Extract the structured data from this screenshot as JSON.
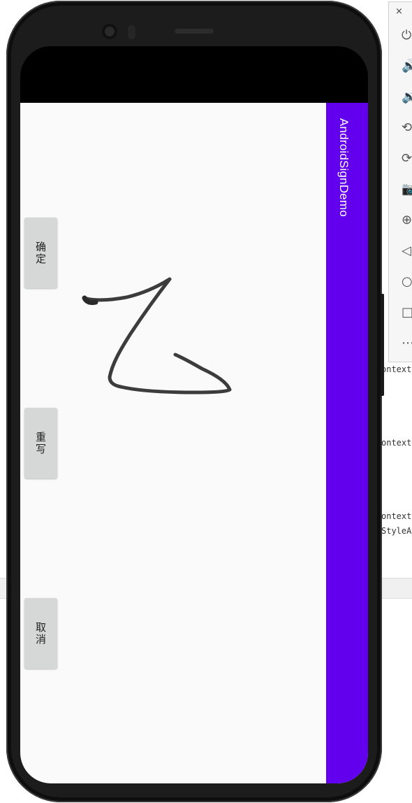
{
  "app": {
    "title": "AndroidSignDemo"
  },
  "buttons": {
    "confirm": "确定",
    "rewrite": "重写",
    "cancel": "取消"
  },
  "emulator_toolbar": {
    "close_label": "×",
    "tools": [
      {
        "name": "power-icon",
        "glyph": "⏻"
      },
      {
        "name": "volume-up-icon",
        "glyph": "🔊"
      },
      {
        "name": "volume-down-icon",
        "glyph": "🔉"
      },
      {
        "name": "rotate-left-icon",
        "glyph": "⟲"
      },
      {
        "name": "rotate-right-icon",
        "glyph": "⟳"
      },
      {
        "name": "camera-icon",
        "glyph": "📷"
      },
      {
        "name": "zoom-icon",
        "glyph": "⊕"
      },
      {
        "name": "back-icon",
        "glyph": "◁"
      },
      {
        "name": "home-icon",
        "glyph": "○"
      },
      {
        "name": "overview-icon",
        "glyph": "□"
      },
      {
        "name": "more-icon",
        "glyph": "⋯"
      }
    ]
  },
  "ide_snippets": [
    "ontext",
    "ontext",
    "ontext",
    "StyleA"
  ],
  "colors": {
    "action_bar": "#6200ee",
    "app_background": "#fafafa",
    "button_background": "#d6d7d7",
    "stroke": "#3c3c3c"
  }
}
